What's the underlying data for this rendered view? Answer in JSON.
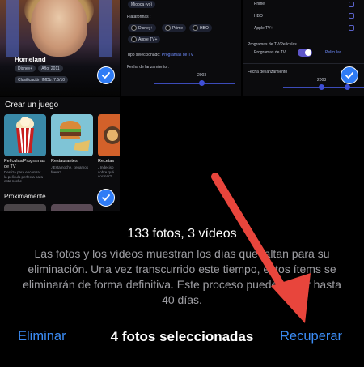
{
  "tiles": {
    "show": {
      "title": "Homeland",
      "pills": [
        "Disney+",
        "Año: 2011"
      ],
      "rating": "Clasificación IMDb: 7.5/10"
    },
    "settings_left": {
      "chip_top": "Miopca (yo)",
      "platforms_label": "Plataformas :",
      "platforms": [
        "Disney+",
        "Prime",
        "HBO",
        "Apple TV+"
      ],
      "type_label": "Tipo seleccionado:",
      "type_value": "Programas de TV",
      "date_label": "Fecha de lanzamiento :",
      "year": "2003"
    },
    "settings_right": {
      "options": [
        "Prime",
        "HBO",
        "Apple TV+"
      ],
      "section": "Programas de TV/Películas",
      "toggle_left": "Programas de TV",
      "toggle_right": "Películas",
      "date_label": "Fecha de lanzamiento",
      "year": "2003"
    },
    "game": {
      "title": "Crear un juego",
      "cards": [
        {
          "title": "Películas/Programas de TV",
          "sub": "Desliza para encontrar la película perfecta para esta noche"
        },
        {
          "title": "Restaurantes",
          "sub": "¿Esta noche, cenamos fuera?"
        },
        {
          "title": "Recetas",
          "sub": "¿Indeciso sobre qué cocinar?"
        }
      ],
      "soon": "Próximamente"
    }
  },
  "summary": {
    "headline": "133 fotos, 3 vídeos",
    "info": "Las fotos y los vídeos muestran los días que faltan para su eliminación. Una vez transcurrido este tiempo, estos ítems se eliminarán de forma definitiva. Este proceso puede tardar hasta 40 días."
  },
  "toolbar": {
    "delete_label": "Eliminar",
    "selection_label": "4 fotos seleccionadas",
    "recover_label": "Recuperar"
  },
  "colors": {
    "accent": "#3b8cf5",
    "check": "#2f7cf6",
    "arrow": "#e8453c"
  }
}
